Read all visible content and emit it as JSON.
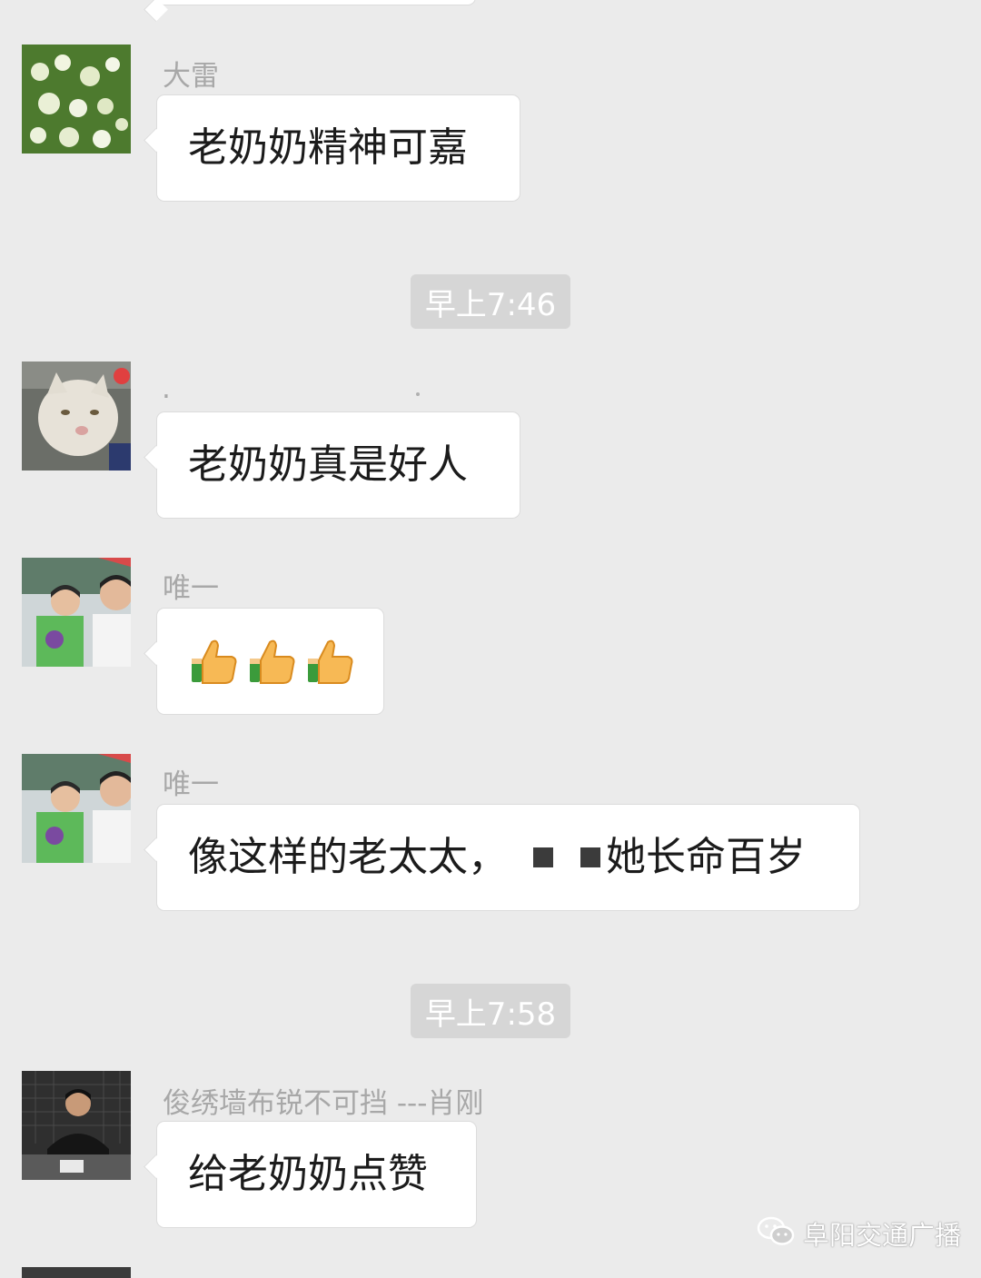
{
  "messages": [
    {
      "sender": "",
      "text": ""
    },
    {
      "sender": "大雷",
      "text": "老奶奶精神可嘉"
    },
    {
      "sender": ".",
      "text": "老奶奶真是好人"
    },
    {
      "sender": "唯一",
      "emoji": [
        "thumbs-up",
        "thumbs-up",
        "thumbs-up"
      ]
    },
    {
      "sender": "唯一",
      "text_a": "像这样的老太太，",
      "text_b": "她长命百岁"
    },
    {
      "sender": "俊绣墙布锐不可挡 ---肖刚",
      "text": "给老奶奶点赞"
    }
  ],
  "timestamps": [
    "早上7:46",
    "早上7:58"
  ],
  "watermark": {
    "text": "阜阳交通广播",
    "icon": "wechat-icon"
  },
  "colors": {
    "background": "#ebebeb",
    "bubble": "#ffffff",
    "name": "#a8a8a8",
    "time_badge": "#d6d6d6"
  }
}
